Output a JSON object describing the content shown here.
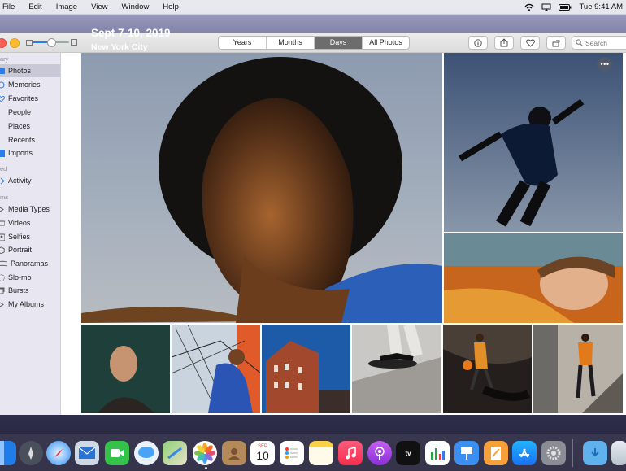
{
  "menubar": {
    "items": [
      "File",
      "Edit",
      "Image",
      "View",
      "Window",
      "Help"
    ],
    "clock": "Tue 9:41 AM"
  },
  "toolbar": {
    "tabs": [
      "Years",
      "Months",
      "Days",
      "All Photos"
    ],
    "active_tab": "Days",
    "search_placeholder": "Search"
  },
  "sidebar": {
    "headings": [
      "ary",
      "ed",
      "ms"
    ],
    "library_items": [
      "Photos",
      "Memories",
      "Favorites",
      "People",
      "Places",
      "Recents",
      "Imports"
    ],
    "shared_items": [
      "Activity"
    ],
    "album_items": [
      "Media Types",
      "Videos",
      "Selfies",
      "Portrait",
      "Panoramas",
      "Slo-mo",
      "Bursts",
      "My Albums"
    ],
    "selected": "Photos"
  },
  "main": {
    "title": "Sept 7-10, 2019",
    "subtitle": "New York City",
    "more_icon": "ellipsis-icon"
  },
  "dock": {
    "apps": [
      "finder",
      "launchpad",
      "safari",
      "mail",
      "facetime",
      "messages",
      "maps",
      "photos",
      "contacts",
      "calendar",
      "reminders",
      "notes",
      "music",
      "podcasts",
      "tv",
      "numbers",
      "keynote",
      "pages",
      "app-store",
      "system-preferences",
      "downloads",
      "trash"
    ],
    "calendar_month": "SEP",
    "calendar_day": "10"
  },
  "colors": {
    "accent": "#2b7de9",
    "sidebar_bg": "#e8e6f1",
    "sidebar_selected": "#c9c8d6"
  }
}
